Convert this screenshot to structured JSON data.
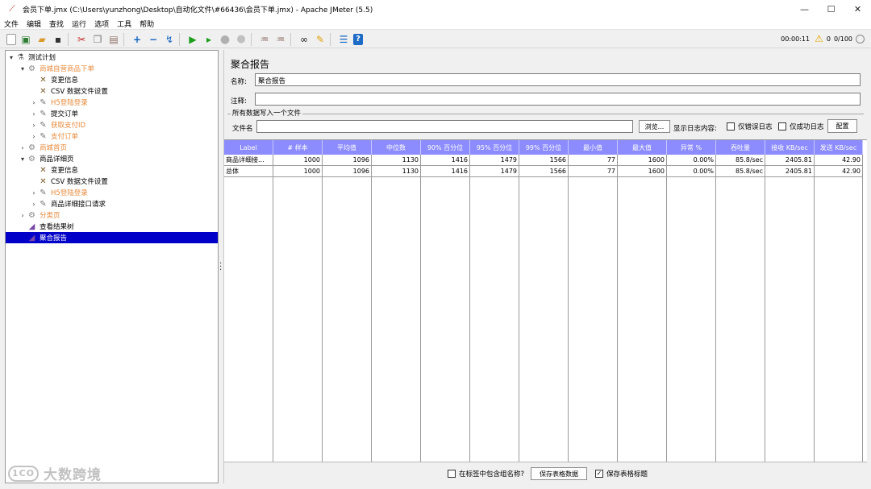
{
  "window": {
    "title": "会员下单.jmx (C:\\Users\\yunzhong\\Desktop\\自动化文件\\#66436\\会员下单.jmx) - Apache JMeter (5.5)",
    "minimize": "—",
    "maximize": "☐",
    "close": "✕"
  },
  "menu": [
    "文件",
    "编辑",
    "查找",
    "运行",
    "选项",
    "工具",
    "帮助"
  ],
  "toolbar": {
    "icons": [
      "new-icon",
      "templates-icon",
      "open-icon",
      "save-icon",
      "cut-icon",
      "copy-icon",
      "paste-icon",
      "expand-icon",
      "collapse-icon",
      "toggle-icon",
      "start-icon",
      "start-no-pause-icon",
      "stop-icon",
      "shutdown-icon",
      "clear-icon",
      "clear-all-icon",
      "search-icon",
      "reset-search-icon",
      "function-helper-icon",
      "help-icon"
    ],
    "timer": "00:00:11",
    "warnings": "0",
    "threads": "0/100"
  },
  "tree": [
    {
      "label": "测试计划",
      "icon": "test-plan-icon",
      "arrow": "▾",
      "disabled": false
    },
    {
      "label": "商城自营商品下单",
      "icon": "thread-group-icon",
      "arrow": "▾",
      "disabled": true
    },
    {
      "label": "变更信息",
      "icon": "config-icon",
      "arrow": "",
      "disabled": false
    },
    {
      "label": "CSV 数据文件设置",
      "icon": "config-icon",
      "arrow": "",
      "disabled": false
    },
    {
      "label": "H5登陆登录",
      "icon": "sampler-icon",
      "arrow": "›",
      "disabled": true
    },
    {
      "label": "提交订单",
      "icon": "sampler-icon",
      "arrow": "›",
      "disabled": false
    },
    {
      "label": "获取支付ID",
      "icon": "sampler-icon",
      "arrow": "›",
      "disabled": true
    },
    {
      "label": "支付订单",
      "icon": "sampler-icon",
      "arrow": "›",
      "disabled": true
    },
    {
      "label": "商城首页",
      "icon": "thread-group-icon",
      "arrow": "›",
      "disabled": true
    },
    {
      "label": "商品详细页",
      "icon": "thread-group-icon",
      "arrow": "▾",
      "disabled": false
    },
    {
      "label": "变更信息",
      "icon": "config-icon",
      "arrow": "",
      "disabled": false
    },
    {
      "label": "CSV 数据文件设置",
      "icon": "config-icon",
      "arrow": "",
      "disabled": false
    },
    {
      "label": "H5登陆登录",
      "icon": "sampler-icon",
      "arrow": "›",
      "disabled": true
    },
    {
      "label": "商品详细接口请求",
      "icon": "sampler-icon",
      "arrow": "›",
      "disabled": false
    },
    {
      "label": "分类页",
      "icon": "thread-group-icon",
      "arrow": "›",
      "disabled": true
    },
    {
      "label": "查看结果树",
      "icon": "listener-icon",
      "arrow": "",
      "disabled": false
    },
    {
      "label": "聚合报告",
      "icon": "listener-icon",
      "arrow": "",
      "disabled": false,
      "selected": true
    }
  ],
  "panel": {
    "title": "聚合报告",
    "name_label": "名称:",
    "name_value": "聚合报告",
    "comment_label": "注释:",
    "comment_value": "",
    "file_group_title": "所有数据写入一个文件",
    "filename_label": "文件名",
    "filename_value": "",
    "browse_button": "浏览...",
    "log_label": "显示日志内容:",
    "errors_only": "仅错误日志",
    "success_only": "仅成功日志",
    "configure_button": "配置"
  },
  "table": {
    "columns": [
      "Label",
      "# 样本",
      "平均值",
      "中位数",
      "90% 百分位",
      "95% 百分位",
      "99% 百分位",
      "最小值",
      "最大值",
      "异常 %",
      "吞吐量",
      "接收 KB/sec",
      "发送 KB/sec"
    ],
    "rows": [
      [
        "商品详细接...",
        "1000",
        "1096",
        "1130",
        "1416",
        "1479",
        "1566",
        "77",
        "1600",
        "0.00%",
        "85.8/sec",
        "2405.81",
        "42.90"
      ],
      [
        "总体",
        "1000",
        "1096",
        "1130",
        "1416",
        "1479",
        "1566",
        "77",
        "1600",
        "0.00%",
        "85.8/sec",
        "2405.81",
        "42.90"
      ]
    ]
  },
  "bottom": {
    "include_group_name": "在标签中包含组名称?",
    "include_group_name_checked": false,
    "save_table_button": "保存表格数据",
    "save_header": "保存表格标题",
    "save_header_checked": true
  },
  "watermark": {
    "logo": "1CO",
    "text": "大数跨境"
  }
}
